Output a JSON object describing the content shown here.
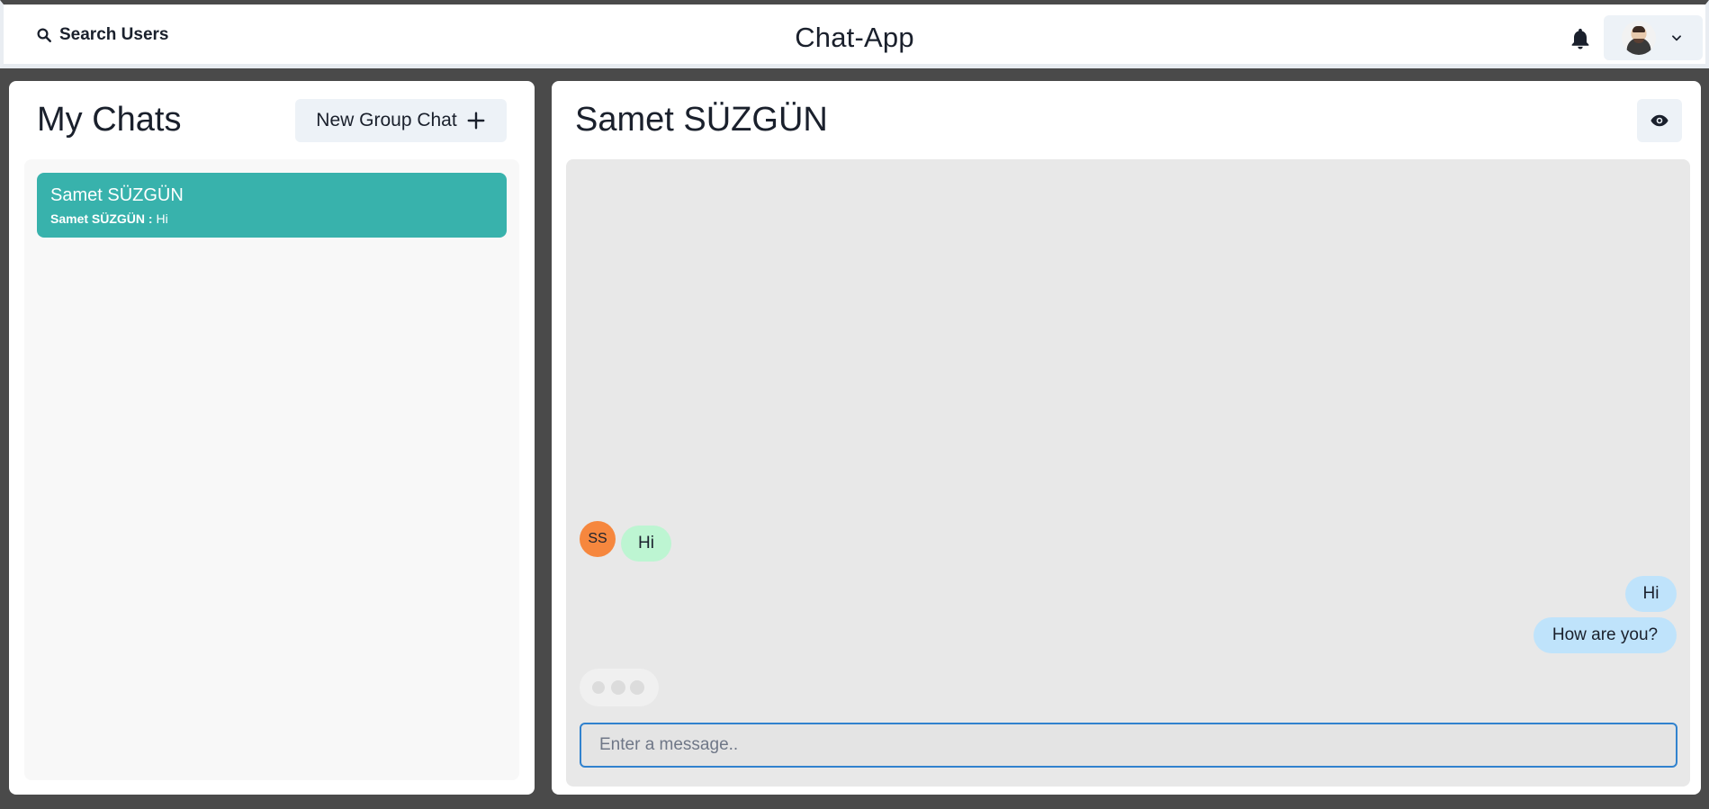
{
  "header": {
    "search_label": "Search Users",
    "app_title": "Chat-App"
  },
  "sidebar": {
    "title": "My Chats",
    "new_group_label": "New Group Chat",
    "chats": [
      {
        "name": "Samet SÜZGÜN",
        "latest_sender": "Samet SÜZGÜN :",
        "latest_message": "Hi"
      }
    ]
  },
  "chat": {
    "title": "Samet SÜZGÜN",
    "sender_initials": "SS",
    "messages": [
      {
        "from": "other",
        "text": "Hi"
      },
      {
        "from": "me",
        "text": "Hi"
      },
      {
        "from": "me",
        "text": "How are you?"
      }
    ],
    "input_placeholder": "Enter a message.."
  },
  "colors": {
    "accent": "#38b2ac",
    "incoming_bubble": "#bdf5d2",
    "outgoing_bubble": "#bfe3fb",
    "avatar_bg": "#f6873e",
    "input_focus": "#3182ce"
  },
  "icons": {
    "search": "search-icon",
    "bell": "bell-icon",
    "chevron": "chevron-down-icon",
    "plus": "plus-icon",
    "eye": "eye-icon"
  }
}
